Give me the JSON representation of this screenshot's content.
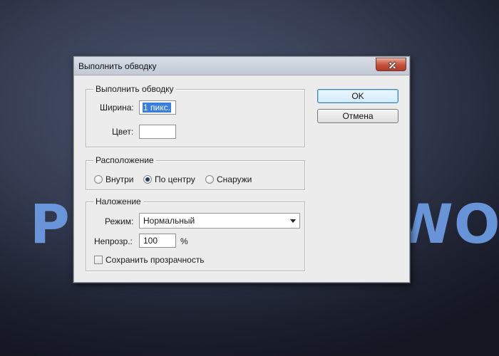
{
  "background": {
    "text_left": "P",
    "text_right": "WO"
  },
  "dialog": {
    "title": "Выполнить обводку",
    "stroke_group": {
      "label": "Выполнить обводку",
      "width_label": "Ширина:",
      "width_value": "1 пикс.",
      "color_label": "Цвет:",
      "color_value": "#ffffff"
    },
    "location_group": {
      "label": "Расположение",
      "options": [
        {
          "label": "Внутри",
          "checked": false
        },
        {
          "label": "По центру",
          "checked": true
        },
        {
          "label": "Снаружи",
          "checked": false
        }
      ]
    },
    "blend_group": {
      "label": "Наложение",
      "mode_label": "Режим:",
      "mode_value": "Нормальный",
      "opacity_label": "Непрозр.:",
      "opacity_value": "100",
      "opacity_unit": "%",
      "preserve_transparency_label": "Сохранить прозрачность",
      "preserve_transparency_checked": false
    },
    "buttons": {
      "ok": "OK",
      "cancel": "Отмена"
    }
  },
  "colors": {
    "background_gradient": [
      "#4c5670",
      "#141722"
    ],
    "canvas_text": "#6e9de6",
    "selection": "#3a7de0",
    "close_button": "#c74f3a"
  }
}
